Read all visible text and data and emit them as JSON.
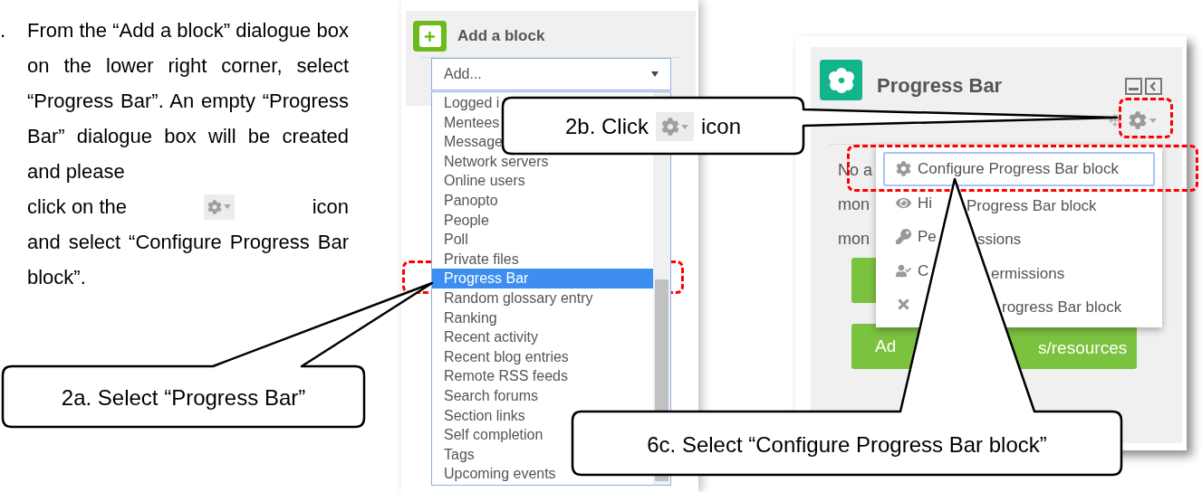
{
  "instruction": {
    "marker": ".",
    "text_before": "From the “Add a block” dialogue box on the lower right corner, select “Progress Bar”.  An empty “Progress Bar” dialogue box will be created and please",
    "icon_line_before": "click on the",
    "icon_line_after": "icon",
    "text_after": "and select “Configure Progress Bar block”."
  },
  "add_block_panel": {
    "title": "Add a block",
    "select_value": "Add...",
    "options": [
      {
        "label": "Logged i",
        "selected": false
      },
      {
        "label": "Mentees",
        "selected": false
      },
      {
        "label": "Message",
        "selected": false
      },
      {
        "label": "Network servers",
        "selected": false
      },
      {
        "label": "Online users",
        "selected": false
      },
      {
        "label": "Panopto",
        "selected": false
      },
      {
        "label": "People",
        "selected": false
      },
      {
        "label": "Poll",
        "selected": false
      },
      {
        "label": "Private files",
        "selected": false
      },
      {
        "label": "Progress Bar",
        "selected": true
      },
      {
        "label": "Random glossary entry",
        "selected": false
      },
      {
        "label": "Ranking",
        "selected": false
      },
      {
        "label": "Recent activity",
        "selected": false
      },
      {
        "label": "Recent blog entries",
        "selected": false
      },
      {
        "label": "Remote RSS feeds",
        "selected": false
      },
      {
        "label": "Search forums",
        "selected": false
      },
      {
        "label": "Section links",
        "selected": false
      },
      {
        "label": "Self completion",
        "selected": false
      },
      {
        "label": "Tags",
        "selected": false
      },
      {
        "label": "Upcoming events",
        "selected": false
      }
    ]
  },
  "progress_bar_block": {
    "title": "Progress Bar",
    "content_lines": [
      "No a",
      "mon",
      "mon"
    ],
    "menu": [
      {
        "kind": "gear",
        "before": "Configure Progress Bar block",
        "focused": true
      },
      {
        "kind": "eye",
        "before": "Hi",
        "after": "Progress Bar block",
        "focused": false
      },
      {
        "kind": "key",
        "before": "Pe",
        "after": "ssions",
        "focused": false
      },
      {
        "kind": "user",
        "before": "C",
        "after": "ermissions",
        "focused": false
      },
      {
        "kind": "cross",
        "after": "rogress Bar block",
        "focused": false
      }
    ],
    "button_parts": [
      "Ad",
      "s/resources"
    ]
  },
  "callouts": [
    {
      "text_before": "2b. Click",
      "text_after": "icon"
    },
    {
      "text": "2a. Select “Progress Bar”"
    },
    {
      "text": "6c. Select “Configure Progress Bar block”"
    }
  ]
}
